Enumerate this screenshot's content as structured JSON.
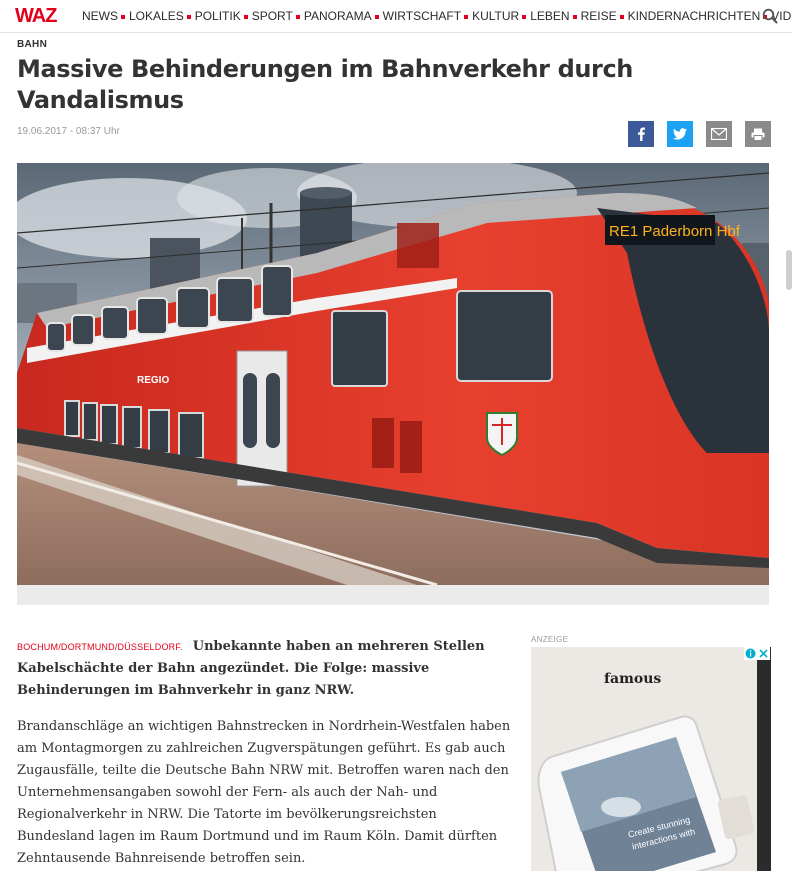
{
  "header": {
    "logo": "WAZ",
    "nav": [
      "NEWS",
      "LOKALES",
      "POLITIK",
      "SPORT",
      "PANORAMA",
      "WIRTSCHAFT",
      "KULTUR",
      "LEBEN",
      "REISE",
      "KINDERNACHRICHTEN",
      "VIDEO"
    ],
    "search_icon": "search-icon"
  },
  "article": {
    "kicker": "BAHN",
    "headline": "Massive Behinderungen im Bahnverkehr durch Vandalismus",
    "dateline": "19.06.2017 - 08:37 Uhr",
    "share": [
      {
        "icon": "facebook-icon"
      },
      {
        "icon": "twitter-icon"
      },
      {
        "icon": "mail-icon"
      },
      {
        "icon": "print-icon"
      }
    ],
    "image": {
      "destination_display": "RE1 Paderborn Hbf",
      "train_label": "REGIO"
    },
    "location": "BOCHUM/DORTMUND/DÜSSELDORF.",
    "lead": "Unbekannte haben an mehreren Stellen Kabelschächte der Bahn angezündet. Die Folge: massive Behinderungen im Bahnverkehr in ganz NRW.",
    "body": "Brandanschläge an wichtigen Bahnstrecken in Nordrhein-Westfalen haben am Montagmorgen zu zahlreichen Zugverspätungen geführt. Es gab auch Zugausfälle, teilte die Deutsche Bahn NRW mit. Betroffen waren nach den Unternehmensangaben sowohl der Fern- als auch der Nah- und Regionalverkehr in NRW. Die Tatorte im bevölkerungsreichsten Bundesland lagen im Raum Dortmund und im Raum Köln. Damit dürften Zehntausende Bahnreisende betroffen sein."
  },
  "ad": {
    "label": "ANZEIGE",
    "brand": "famous",
    "screen_line1": "Create stunning",
    "screen_line2": "interactions with",
    "colors": {
      "brand_red": "#e2001a",
      "facebook": "#3b5998",
      "twitter": "#1da1f2"
    }
  }
}
